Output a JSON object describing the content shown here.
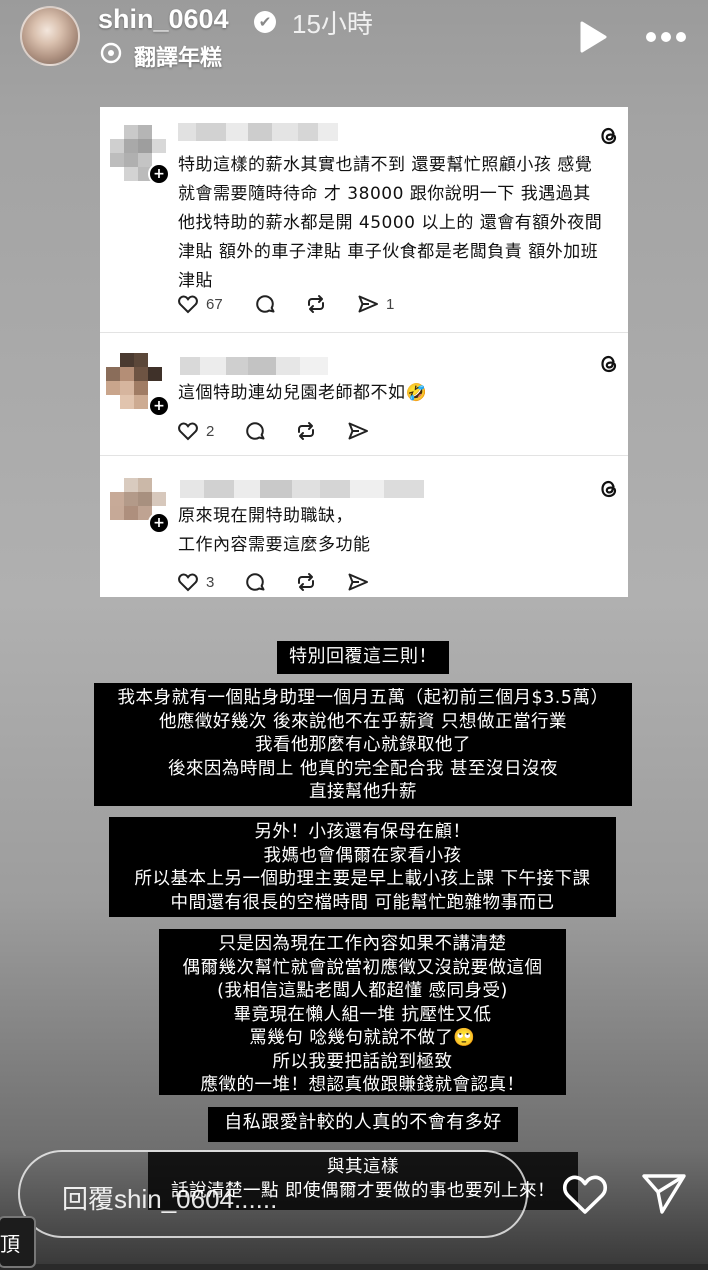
{
  "header": {
    "username": "shin_0604",
    "verified_glyph": "✔",
    "time": "15小時",
    "translate_label": "翻譯年糕",
    "icons": [
      "translate-icon",
      "play-icon",
      "more-icon"
    ]
  },
  "threads": [
    {
      "text": "特助這樣的薪水其實也請不到 還要幫忙照顧小孩 感覺就會需要隨時待命 才 38000 跟你說明一下 我遇過其他找特助的薪水都是開 45000 以上的 還會有額外夜間津貼 額外的車子津貼 車子伙食都是老闆負責 額外加班津貼",
      "likes": "67",
      "shares": "1"
    },
    {
      "text": "這個特助連幼兒園老師都不如🤣",
      "likes": "2",
      "shares": ""
    },
    {
      "text_line1": "原來現在開特助職缺，",
      "text_line2": "工作內容需要這麼多功能",
      "likes": "3",
      "shares": ""
    }
  ],
  "boxes": {
    "b1": [
      "特別回覆這三則！"
    ],
    "b2": [
      "我本身就有一個貼身助理一個月五萬（起初前三個月$3.5萬）",
      "他應徵好幾次 後來說他不在乎薪資 只想做正當行業",
      "我看他那麼有心就錄取他了",
      "後來因為時間上 他真的完全配合我 甚至沒日沒夜",
      "直接幫他升薪"
    ],
    "b3": [
      "另外！小孩還有保母在顧！",
      "我媽也會偶爾在家看小孩",
      "所以基本上另一個助理主要是早上載小孩上課 下午接下課",
      "中間還有很長的空檔時間 可能幫忙跑雜物事而已"
    ],
    "b4": [
      "只是因為現在工作內容如果不講清楚",
      "偶爾幾次幫忙就會說當初應徵又沒說要做這個",
      "(我相信這點老闆人都超懂 感同身受)",
      "畢竟現在懶人組一堆 抗壓性又低",
      "罵幾句 唸幾句就說不做了🙄",
      "所以我要把話說到極致",
      "應徵的一堆！想認真做跟賺錢就會認真！"
    ],
    "b5": [
      "自私跟愛計較的人真的不會有多好"
    ],
    "b6": [
      "與其這樣",
      "話說清楚一點 即使偶爾才要做的事也要列上來！"
    ]
  },
  "reply": {
    "placeholder": "回覆shin_0604......",
    "corner_text": "頂"
  },
  "colors": {
    "box_bg": "#000000",
    "card_bg": "#ffffff",
    "text_white": "#ffffff"
  }
}
